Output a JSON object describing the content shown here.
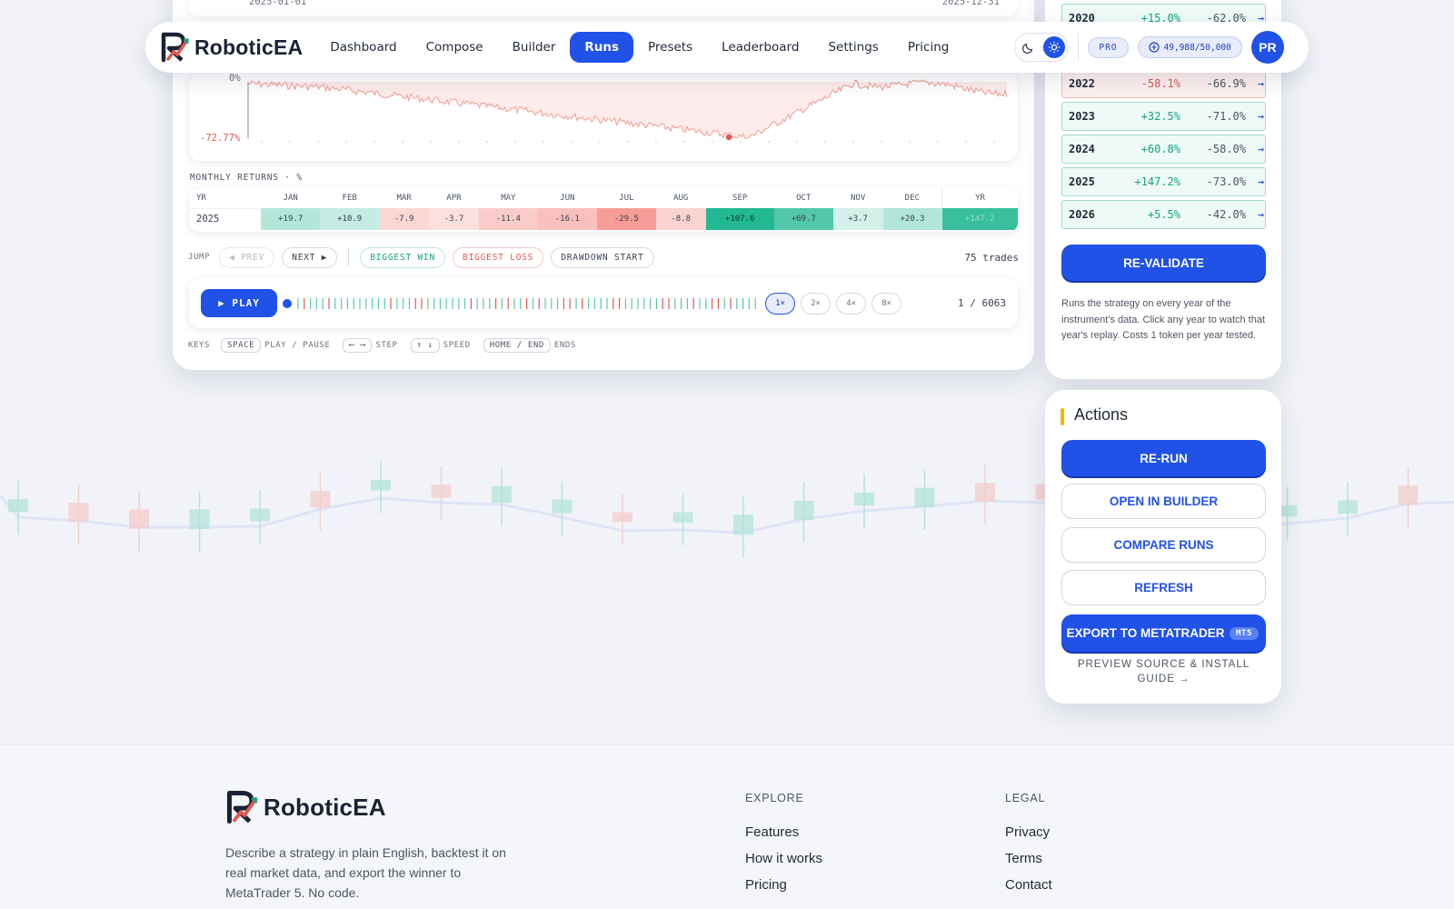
{
  "nav": {
    "brand": "RoboticEA",
    "links": [
      "Dashboard",
      "Compose",
      "Builder",
      "Runs",
      "Presets",
      "Leaderboard",
      "Settings",
      "Pricing"
    ],
    "active": "Runs",
    "plan": "PRO",
    "tokens": "49,988/50,000",
    "avatar": "PR",
    "theme_icons": [
      "moon-icon",
      "sun-icon"
    ]
  },
  "equity": {
    "date_start": "2025-01-01",
    "date_end": "2025-12-31"
  },
  "drawdown": {
    "top_label": "0%",
    "bottom_label": "-72.77%"
  },
  "monthly": {
    "title": "MONTHLY RETURNS · %",
    "headers": [
      "YR",
      "JAN",
      "FEB",
      "MAR",
      "APR",
      "MAY",
      "JUN",
      "JUL",
      "AUG",
      "SEP",
      "OCT",
      "NOV",
      "DEC",
      "YR"
    ],
    "year": "2025",
    "values": [
      "+19.7",
      "+10.9",
      "-7.9",
      "-3.7",
      "-11.4",
      "-16.1",
      "-29.5",
      "-8.8",
      "+107.6",
      "+69.7",
      "+3.7",
      "+20.3",
      "+147.2"
    ]
  },
  "jump": {
    "label": "JUMP",
    "prev": "◀ PREV",
    "next": "NEXT ▶",
    "biggest_win": "BIGGEST WIN",
    "biggest_loss": "BIGGEST LOSS",
    "drawdown_start": "DRAWDOWN START",
    "trades": "75 trades"
  },
  "player": {
    "play": "▶ PLAY",
    "speeds": [
      "1×",
      "2×",
      "4×",
      "8×"
    ],
    "selected_speed": "1×",
    "position": "1 / 6063"
  },
  "keys": {
    "label": "KEYS",
    "space": "SPACE",
    "play_pause": "PLAY / PAUSE",
    "step_keys": "⟵ ⟶",
    "step": "STEP",
    "speed_keys": "↑ ↓",
    "speed": "SPEED",
    "ends_keys": "HOME / END",
    "ends": "ENDS"
  },
  "years": [
    {
      "year": "2020",
      "ret": "+15.0%",
      "dd": "-62.0%",
      "arrow": "→",
      "win": true
    },
    {
      "year": "2022",
      "ret": "-58.1%",
      "dd": "-66.9%",
      "arrow": "→",
      "win": false
    },
    {
      "year": "2023",
      "ret": "+32.5%",
      "dd": "-71.0%",
      "arrow": "→",
      "win": true
    },
    {
      "year": "2024",
      "ret": "+60.8%",
      "dd": "-58.0%",
      "arrow": "→",
      "win": true
    },
    {
      "year": "2025",
      "ret": "+147.2%",
      "dd": "-73.0%",
      "arrow": "→",
      "win": true
    },
    {
      "year": "2026",
      "ret": "+5.5%",
      "dd": "-42.0%",
      "arrow": "→",
      "win": true
    }
  ],
  "revalidate": {
    "button": "RE-VALIDATE",
    "description": "Runs the strategy on every year of the instrument's data. Click any year to watch that year's replay. Costs 1 token per year tested."
  },
  "actions": {
    "title": "Actions",
    "rerun": "RE-RUN",
    "open_builder": "OPEN IN BUILDER",
    "compare": "COMPARE RUNS",
    "refresh": "REFRESH",
    "export": "EXPORT TO METATRADER",
    "export_badge": "MT5",
    "preview": "PREVIEW SOURCE & INSTALL GUIDE →"
  },
  "footer": {
    "brand": "RoboticEA",
    "tagline": "Describe a strategy in plain English, backtest it on real market data, and export the winner to MetaTrader 5. No code.",
    "explore_title": "EXPLORE",
    "explore": [
      "Features",
      "How it works",
      "Pricing"
    ],
    "legal_title": "LEGAL",
    "legal": [
      "Privacy",
      "Terms",
      "Contact"
    ]
  },
  "colors": {
    "accent": "#2052e8",
    "positive": "#16a37f",
    "negative": "#e0584f"
  }
}
